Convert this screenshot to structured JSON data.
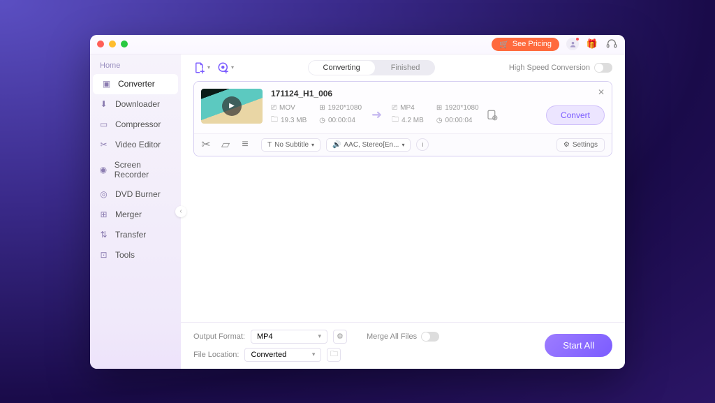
{
  "colors": {
    "accent": "#7b5cff",
    "pricing": "#ff6a3d"
  },
  "titlebar": {
    "pricing_label": "See Pricing"
  },
  "sidebar": {
    "home_label": "Home",
    "items": [
      {
        "label": "Converter"
      },
      {
        "label": "Downloader"
      },
      {
        "label": "Compressor"
      },
      {
        "label": "Video Editor"
      },
      {
        "label": "Screen Recorder"
      },
      {
        "label": "DVD Burner"
      },
      {
        "label": "Merger"
      },
      {
        "label": "Transfer"
      },
      {
        "label": "Tools"
      }
    ]
  },
  "toolbar": {
    "tabs": {
      "converting": "Converting",
      "finished": "Finished"
    },
    "hsc_label": "High Speed Conversion"
  },
  "file": {
    "name": "171124_H1_006",
    "src": {
      "format": "MOV",
      "resolution": "1920*1080",
      "size": "19.3 MB",
      "duration": "00:00:04"
    },
    "dst": {
      "format": "MP4",
      "resolution": "1920*1080",
      "size": "4.2 MB",
      "duration": "00:00:04"
    },
    "subtitle_label": "No Subtitle",
    "audio_label": "AAC, Stereo[En...",
    "settings_label": "Settings",
    "convert_label": "Convert"
  },
  "footer": {
    "output_format_label": "Output Format:",
    "output_format_value": "MP4",
    "file_location_label": "File Location:",
    "file_location_value": "Converted",
    "merge_label": "Merge All Files",
    "start_all_label": "Start All"
  }
}
